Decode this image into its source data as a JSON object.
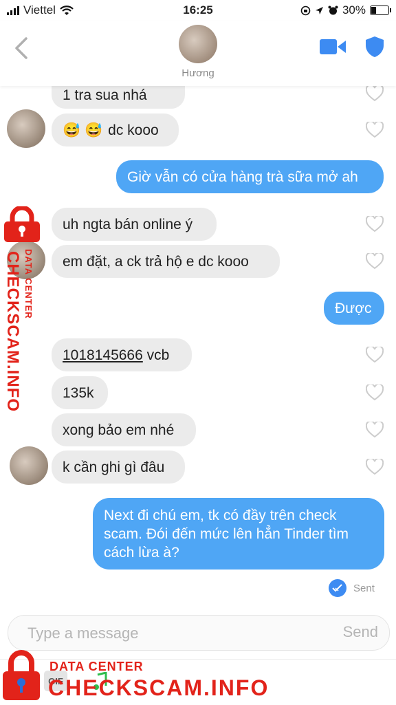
{
  "status_bar": {
    "carrier": "Viettel",
    "time": "16:25",
    "battery": "30%"
  },
  "header": {
    "contact_name": "Hương"
  },
  "messages": [
    {
      "side": "in",
      "text": "1 tra sua nhá"
    },
    {
      "side": "in",
      "text": "dc kooo",
      "emoji": "😅 😅"
    },
    {
      "side": "out",
      "text": "Giờ vẫn có cửa hàng trà sữa mở ah"
    },
    {
      "side": "in",
      "text": "uh ngta bán online ý"
    },
    {
      "side": "in",
      "text": "em đặt, a ck trả hộ e dc kooo"
    },
    {
      "side": "out",
      "text": "Được"
    },
    {
      "side": "in",
      "text": " vcb",
      "account": "1018145666"
    },
    {
      "side": "in",
      "text": "135k"
    },
    {
      "side": "in",
      "text": "xong bảo em nhé"
    },
    {
      "side": "in",
      "text": "k cần ghi gì đâu"
    },
    {
      "side": "out",
      "lines": [
        "Next đi chú em, tk có đầy trên check",
        "scam. Đói đến mức lên hẳn Tinder tìm",
        "cách lừa à?"
      ]
    }
  ],
  "sent_status": "Sent",
  "composer": {
    "placeholder": "Type a message",
    "send_label": "Send",
    "gif_label": "GIF"
  },
  "watermark": {
    "line1": "DATA CENTER",
    "line2": "CHECKSCAM.INFO",
    "color": "#e2231a"
  },
  "colors": {
    "outgoing_bubble": "#4fa6f5",
    "incoming_bubble": "#ebebeb",
    "accent": "#3d8bf2"
  }
}
